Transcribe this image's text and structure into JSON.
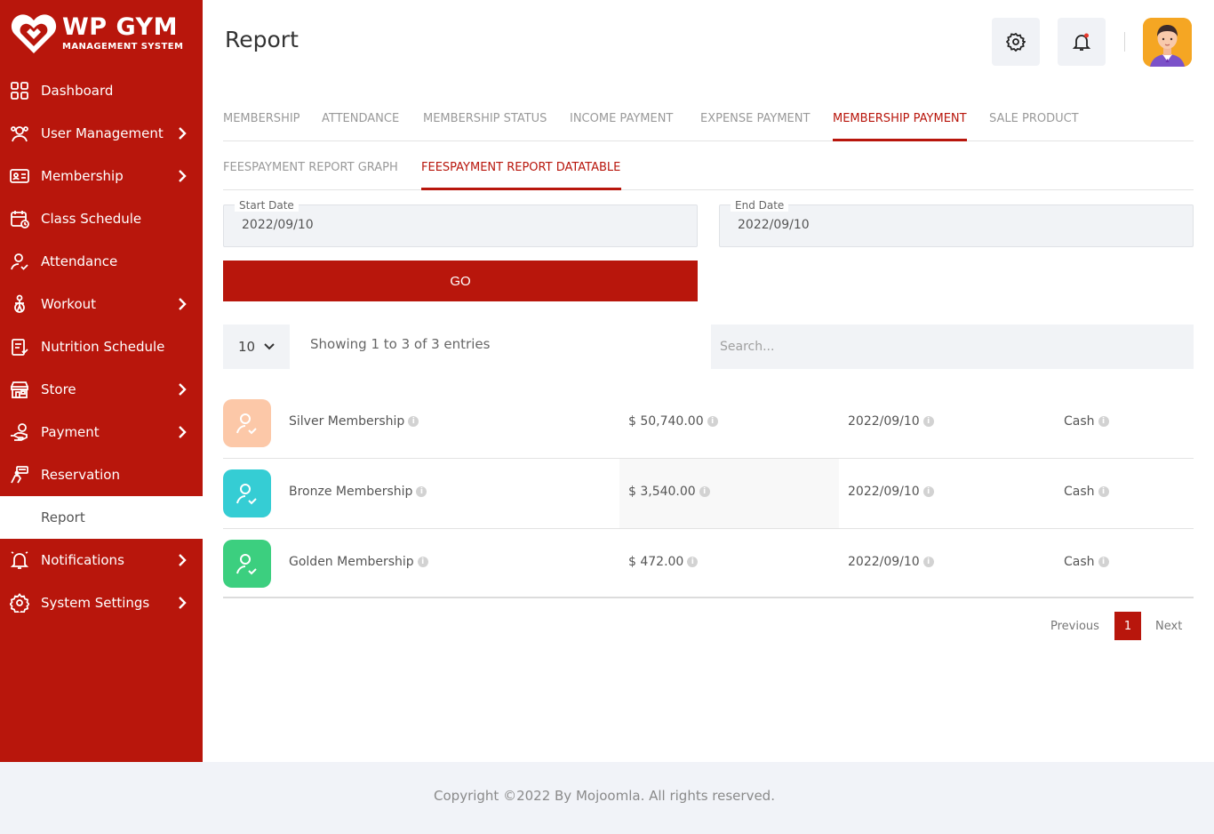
{
  "brand": {
    "title": "WP GYM",
    "subtitle": "MANAGEMENT SYSTEM"
  },
  "sidebar": {
    "items": [
      {
        "label": "Dashboard",
        "icon": "dashboard-icon",
        "has_children": false
      },
      {
        "label": "User Management",
        "icon": "users-icon",
        "has_children": true
      },
      {
        "label": "Membership",
        "icon": "membership-card-icon",
        "has_children": true
      },
      {
        "label": "Class Schedule",
        "icon": "calendar-icon",
        "has_children": false
      },
      {
        "label": "Attendance",
        "icon": "user-check-icon",
        "has_children": false
      },
      {
        "label": "Workout",
        "icon": "workout-icon",
        "has_children": true
      },
      {
        "label": "Nutrition Schedule",
        "icon": "nutrition-icon",
        "has_children": false
      },
      {
        "label": "Store",
        "icon": "store-icon",
        "has_children": true
      },
      {
        "label": "Payment",
        "icon": "payment-icon",
        "has_children": true
      },
      {
        "label": "Reservation",
        "icon": "reservation-icon",
        "has_children": false
      },
      {
        "label": "Report",
        "icon": "report-icon",
        "has_children": false,
        "active": true
      },
      {
        "label": "Notifications",
        "icon": "bell-icon",
        "has_children": true
      },
      {
        "label": "System Settings",
        "icon": "gear-icon",
        "has_children": true
      }
    ]
  },
  "header": {
    "title": "Report"
  },
  "tabs": [
    {
      "label": "MEMBERSHIP"
    },
    {
      "label": "ATTENDANCE"
    },
    {
      "label": "MEMBERSHIP STATUS"
    },
    {
      "label": "INCOME PAYMENT"
    },
    {
      "label": "EXPENSE PAYMENT"
    },
    {
      "label": "MEMBERSHIP PAYMENT",
      "active": true
    },
    {
      "label": "SALE PRODUCT"
    }
  ],
  "subtabs": [
    {
      "label": "FEESPAYMENT REPORT GRAPH"
    },
    {
      "label": "FEESPAYMENT REPORT DATATABLE",
      "active": true
    }
  ],
  "filters": {
    "start_label": "Start Date",
    "start_value": "2022/09/10",
    "end_label": "End Date",
    "end_value": "2022/09/10",
    "go_label": "GO"
  },
  "table_controls": {
    "length": "10",
    "info": "Showing 1 to 3 of 3 entries",
    "search_placeholder": "Search..."
  },
  "rows": [
    {
      "name": "Silver Membership",
      "amount": "$ 50,740.00",
      "date": "2022/09/10",
      "method": "Cash",
      "icon_color": "#fcc8a8"
    },
    {
      "name": "Bronze Membership",
      "amount": "$ 3,540.00",
      "date": "2022/09/10",
      "method": "Cash",
      "icon_color": "#35cdd4"
    },
    {
      "name": "Golden Membership",
      "amount": "$ 472.00",
      "date": "2022/09/10",
      "method": "Cash",
      "icon_color": "#3ccf7f"
    }
  ],
  "pagination": {
    "previous": "Previous",
    "current": "1",
    "next": "Next"
  },
  "footer": {
    "text": "Copyright ©2022 By Mojoomla. All rights reserved."
  },
  "colors": {
    "brand": "#b8160c",
    "panel": "#f1f3f6"
  }
}
